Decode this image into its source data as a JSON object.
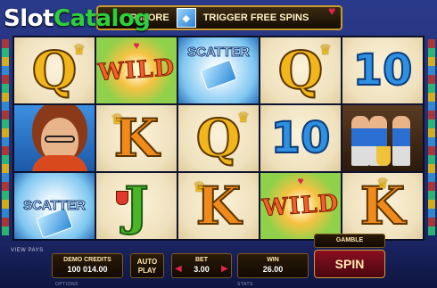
{
  "watermark": {
    "part1": "Slot",
    "part2": "Catalog"
  },
  "banner": {
    "left_text": "R MORE",
    "right_text": "TRIGGER FREE SPINS"
  },
  "reels": [
    [
      "Q",
      "portrait",
      "SCATTER"
    ],
    [
      "WILD",
      "K",
      "J"
    ],
    [
      "SCATTER",
      "Q",
      "K"
    ],
    [
      "Q",
      "10",
      "WILD"
    ],
    [
      "10",
      "team",
      "K"
    ]
  ],
  "symbols": {
    "q": "Q",
    "k": "K",
    "j": "J",
    "ten": "10",
    "wild": "WILD",
    "scatter": "SCATTER"
  },
  "controls": {
    "view_pays": "VIEW PAYS",
    "options": "OPTIONS",
    "stats": "STATS",
    "credits_label": "DEMO CREDITS",
    "credits_value": "100 014.00",
    "autoplay_line1": "AUTO",
    "autoplay_line2": "PLAY",
    "bet_label": "BET",
    "bet_value": "3.00",
    "win_label": "WIN",
    "win_value": "26.00",
    "gamble_label": "GAMBLE",
    "spin_label": "SPIN"
  },
  "colors": {
    "background": "#1e2b6e",
    "spin_button": "#8a1020",
    "panel_border": "#7a5a20",
    "watermark_green": "#2fcf3c"
  }
}
